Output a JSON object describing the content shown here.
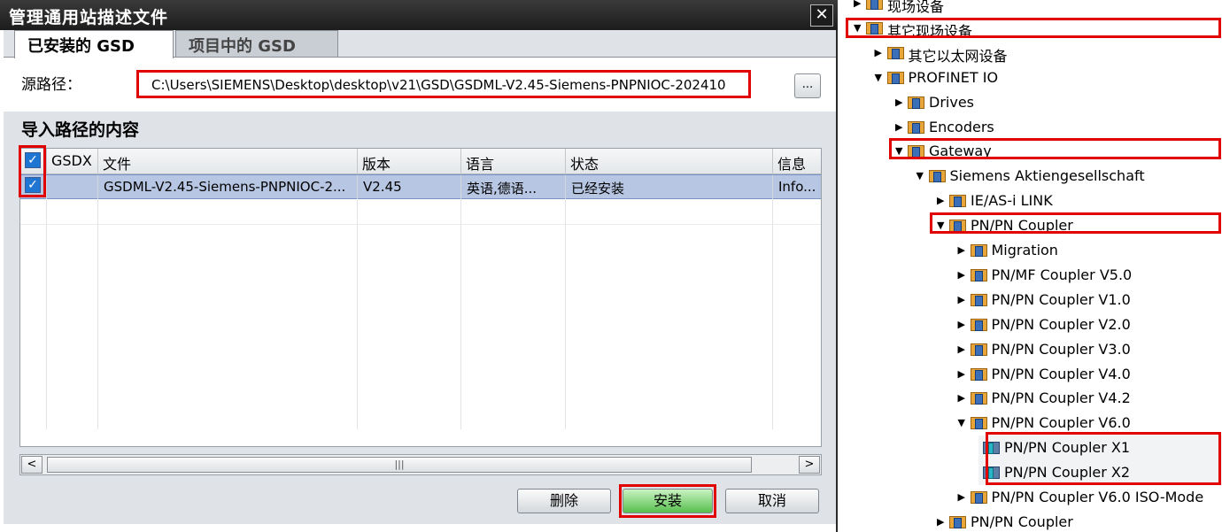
{
  "dialog": {
    "title": "管理通用站描述文件",
    "close_label": "✕",
    "tabs": [
      "已安装的 GSD",
      "项目中的 GSD"
    ],
    "source_label": "源路径：",
    "source_path": "C:\\Users\\SIEMENS\\Desktop\\desktop\\v21\\GSD\\GSDML-V2.45-Siemens-PNPNIOC-202410",
    "browse_label": "...",
    "section_title": "导入路径的内容",
    "table": {
      "columns": [
        "GSDX",
        "文件",
        "版本",
        "语言",
        "状态",
        "信息"
      ],
      "rows": [
        {
          "checked": true,
          "gsdx": "",
          "file": "GSDML-V2.45-Siemens-PNPNIOC-2...",
          "version": "V2.45",
          "language": "英语,德语...",
          "status": "已经安装",
          "info": "Info..."
        }
      ]
    },
    "scroll": {
      "left_arrow": "<",
      "right_arrow": ">",
      "thumb_grip": "|||"
    },
    "buttons": {
      "delete": "删除",
      "install": "安装",
      "cancel": "取消"
    },
    "highlight_color": "#e00000",
    "accent_color": "#1f76d2"
  },
  "tree": {
    "items": [
      {
        "label": "现场设备",
        "level": 0,
        "expanded": false,
        "icon": "folder-icon"
      },
      {
        "label": "其它现场设备",
        "level": 0,
        "expanded": true,
        "icon": "folder-icon"
      },
      {
        "label": "其它以太网设备",
        "level": 1,
        "expanded": false,
        "icon": "folder-icon"
      },
      {
        "label": "PROFINET IO",
        "level": 1,
        "expanded": true,
        "icon": "folder-icon"
      },
      {
        "label": "Drives",
        "level": 2,
        "expanded": false,
        "icon": "folder-icon"
      },
      {
        "label": "Encoders",
        "level": 2,
        "expanded": false,
        "icon": "folder-icon"
      },
      {
        "label": "Gateway",
        "level": 2,
        "expanded": true,
        "icon": "folder-icon"
      },
      {
        "label": "Siemens Aktiengesellschaft",
        "level": 3,
        "expanded": true,
        "icon": "folder-icon"
      },
      {
        "label": "IE/AS-i LINK",
        "level": 4,
        "expanded": false,
        "icon": "folder-icon"
      },
      {
        "label": "PN/PN Coupler",
        "level": 4,
        "expanded": true,
        "icon": "folder-icon"
      },
      {
        "label": "Migration",
        "level": 5,
        "expanded": false,
        "icon": "folder-icon"
      },
      {
        "label": "PN/MF Coupler V5.0",
        "level": 5,
        "expanded": false,
        "icon": "folder-icon"
      },
      {
        "label": "PN/PN Coupler V1.0",
        "level": 5,
        "expanded": false,
        "icon": "folder-icon"
      },
      {
        "label": "PN/PN Coupler V2.0",
        "level": 5,
        "expanded": false,
        "icon": "folder-icon"
      },
      {
        "label": "PN/PN Coupler V3.0",
        "level": 5,
        "expanded": false,
        "icon": "folder-icon"
      },
      {
        "label": "PN/PN Coupler V4.0",
        "level": 5,
        "expanded": false,
        "icon": "folder-icon"
      },
      {
        "label": "PN/PN Coupler V4.2",
        "level": 5,
        "expanded": false,
        "icon": "folder-icon"
      },
      {
        "label": "PN/PN Coupler V6.0",
        "level": 5,
        "expanded": true,
        "icon": "folder-icon"
      },
      {
        "label": "PN/PN Coupler X1",
        "level": 6,
        "leaf": true,
        "icon": "device-icon"
      },
      {
        "label": "PN/PN Coupler X2",
        "level": 6,
        "leaf": true,
        "icon": "device-icon"
      },
      {
        "label": "PN/PN Coupler V6.0 ISO-Mode",
        "level": 5,
        "expanded": false,
        "icon": "folder-icon"
      },
      {
        "label": "PN/PN Coupler",
        "level": 4,
        "expanded": false,
        "icon": "folder-icon"
      }
    ]
  }
}
